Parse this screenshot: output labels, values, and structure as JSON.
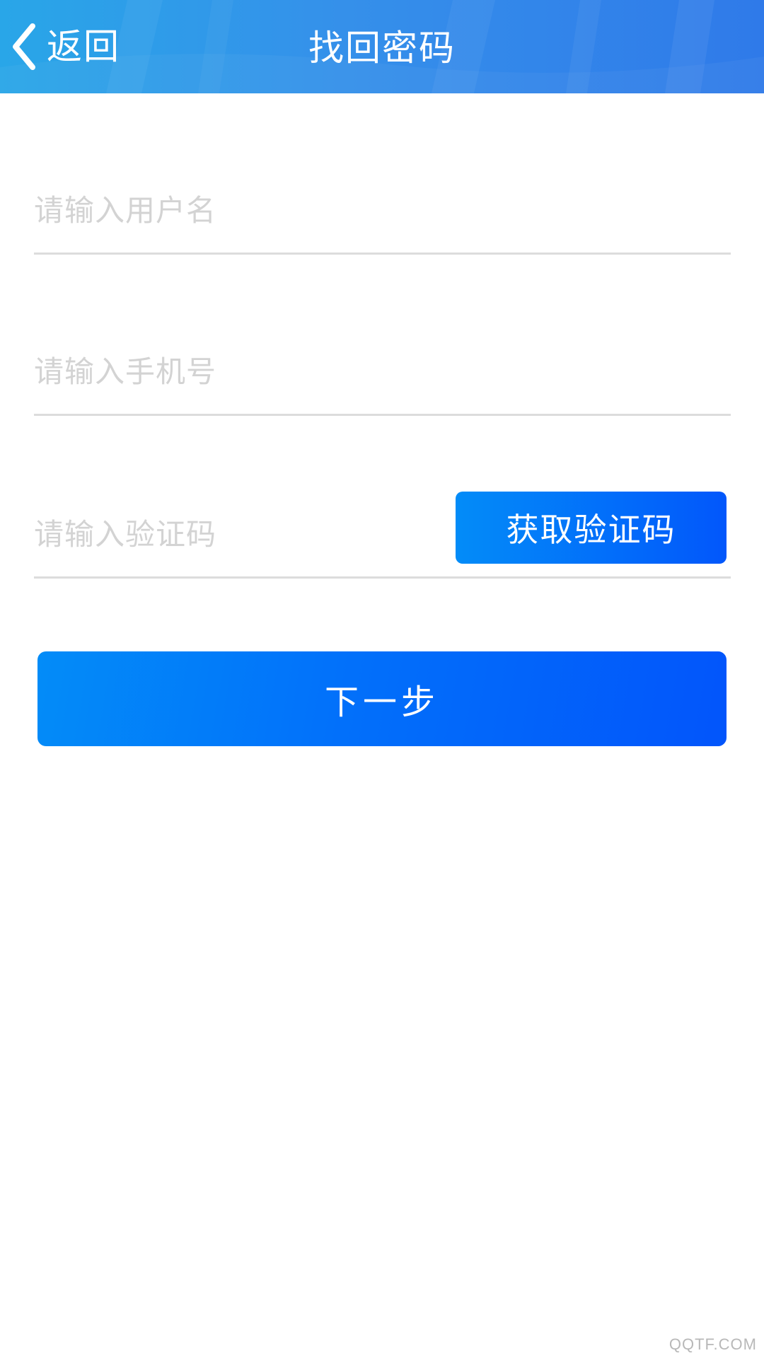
{
  "header": {
    "back_label": "返回",
    "title": "找回密码",
    "background_colors": [
      "#29a6e8",
      "#3590ea",
      "#2f7ae9"
    ]
  },
  "form": {
    "username": {
      "placeholder": "请输入用户名",
      "value": ""
    },
    "phone": {
      "placeholder": "请输入手机号",
      "value": ""
    },
    "code": {
      "placeholder": "请输入验证码",
      "value": ""
    },
    "get_code_label": "获取验证码",
    "next_label": "下一步"
  },
  "colors": {
    "accent_start": "#038cf8",
    "accent_end": "#0257fb",
    "divider": "#dcdcdc",
    "placeholder": "#d3d3d3"
  },
  "icons": {
    "back": "chevron-left-icon"
  },
  "watermark": "QQTF.COM"
}
